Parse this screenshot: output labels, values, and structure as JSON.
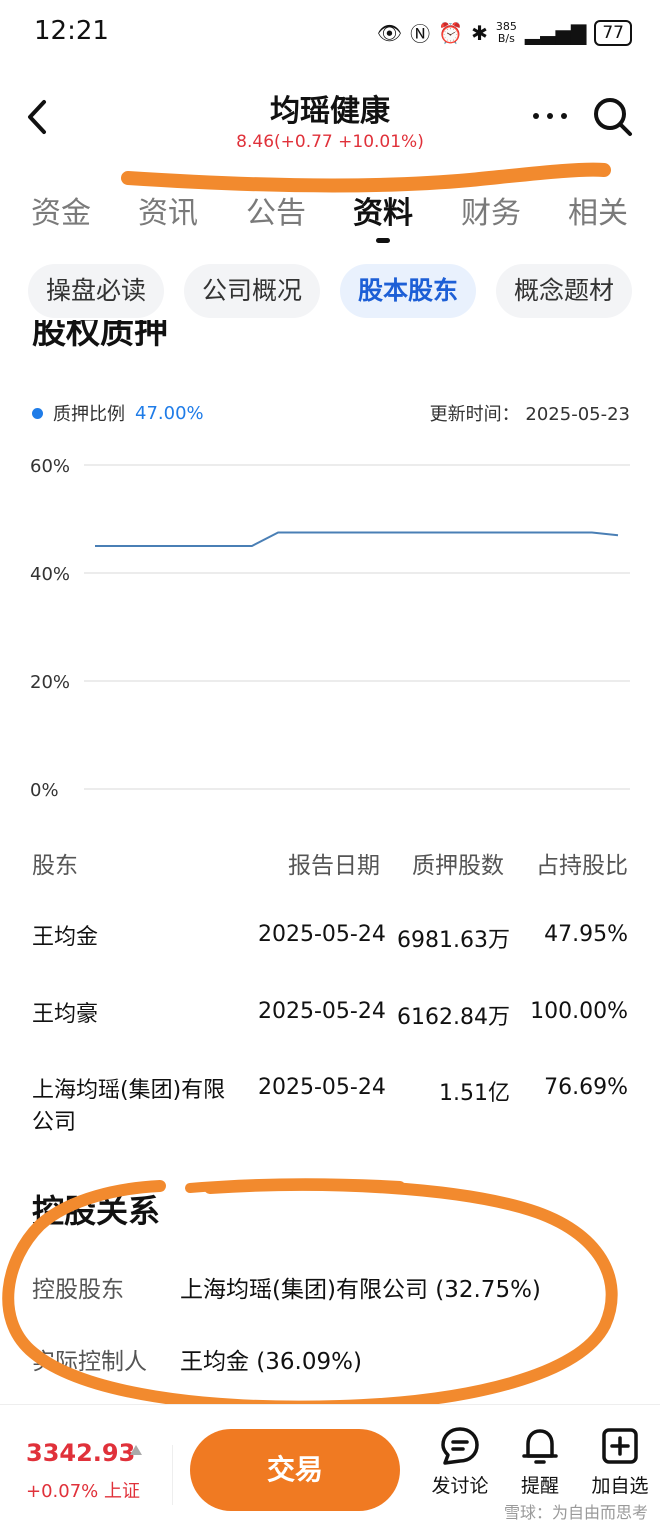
{
  "status_bar": {
    "time": "12:21",
    "net_speed_value": "385",
    "net_speed_unit": "B/s",
    "battery": "77"
  },
  "header": {
    "title": "均瑶健康",
    "quote": "8.46(+0.77 +10.01%)"
  },
  "main_tabs": [
    {
      "label": "资金"
    },
    {
      "label": "资讯"
    },
    {
      "label": "公告"
    },
    {
      "label": "资料"
    },
    {
      "label": "财务"
    },
    {
      "label": "相关"
    }
  ],
  "active_main_tab": "资料",
  "sub_tabs": [
    {
      "label": "操盘必读"
    },
    {
      "label": "公司概况"
    },
    {
      "label": "股本股东"
    },
    {
      "label": "概念题材"
    }
  ],
  "active_sub_tab": "股本股东",
  "pledge_section": {
    "heading": "股权质押",
    "legend_label": "质押比例",
    "legend_value": "47.00%",
    "update_label": "更新时间：",
    "update_date": "2025-05-23"
  },
  "chart_data": {
    "type": "line",
    "title": "",
    "xlabel": "",
    "ylabel": "",
    "ylim": [
      0,
      60
    ],
    "yticks": [
      "0%",
      "20%",
      "40%",
      "60%"
    ],
    "grid": true,
    "series": [
      {
        "name": "质押比例",
        "color": "#4a7fb5",
        "values": [
          45,
          45,
          45,
          45,
          45,
          45,
          45,
          47.5,
          47.5,
          47.5,
          47.5,
          47.5,
          47.5,
          47.5,
          47.5,
          47.5,
          47.5,
          47.5,
          47.5,
          47.5,
          47.0
        ]
      }
    ]
  },
  "table": {
    "headers": {
      "holder": "股东",
      "date": "报告日期",
      "shares": "质押股数",
      "ratio": "占持股比"
    },
    "rows": [
      {
        "holder": "王均金",
        "date": "2025-05-24",
        "shares": "6981.63万",
        "ratio": "47.95%"
      },
      {
        "holder": "王均豪",
        "date": "2025-05-24",
        "shares": "6162.84万",
        "ratio": "100.00%"
      },
      {
        "holder": "上海均瑶(集团)有限公司",
        "date": "2025-05-24",
        "shares": "1.51亿",
        "ratio": "76.69%"
      }
    ]
  },
  "control": {
    "heading": "控股关系",
    "controlling_label": "控股股东",
    "controlling_value": "上海均瑶(集团)有限公司 (32.75%)",
    "actual_label": "实际控制人",
    "actual_value": "王均金 (36.09%)"
  },
  "bottom_bar": {
    "index_value": "3342.93",
    "index_change": "+0.07% 上证",
    "trade_label": "交易",
    "discuss_label": "发讨论",
    "remind_label": "提醒",
    "add_watch_label": "加自选",
    "watermark": "雪球：为自由而思考"
  },
  "colors": {
    "accent_blue": "#1d5fd6",
    "up_red": "#e0313a",
    "trade_orange": "#f07a22",
    "annotation_orange": "#f28a2e"
  }
}
